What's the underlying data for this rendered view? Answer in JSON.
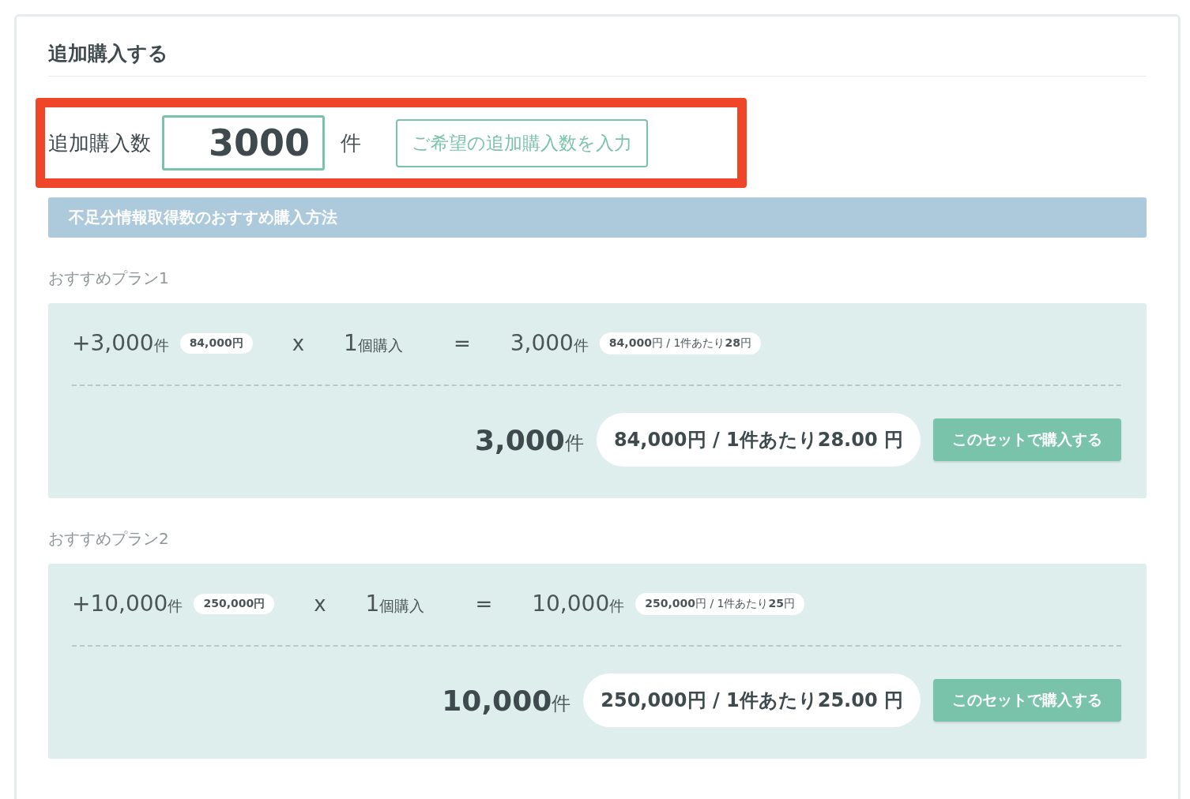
{
  "title": "追加購入する",
  "quantity": {
    "label": "追加購入数",
    "value": "3000",
    "unit": "件",
    "hint": "ご希望の追加購入数を入力",
    "highlighted": true
  },
  "section_bar": "不足分情報取得数のおすすめ購入方法",
  "plans": [
    {
      "title": "おすすめプラン1",
      "amount": "+3,000",
      "amount_unit": "件",
      "price": "84,000円",
      "times": "x",
      "count": "1",
      "count_unit": "個購入",
      "equals": "=",
      "result": "3,000",
      "result_unit": "件",
      "result_price": "**84,000**円 / 1件あたり**28**円",
      "total": "3,000",
      "total_unit": "件",
      "total_price": "**84,000**円 / 1件あたり28.00 円",
      "button": "このセットで購入する"
    },
    {
      "title": "おすすめプラン2",
      "amount": "+10,000",
      "amount_unit": "件",
      "price": "250,000円",
      "times": "x",
      "count": "1",
      "count_unit": "個購入",
      "equals": "=",
      "result": "10,000",
      "result_unit": "件",
      "result_price": "**250,000**円 / 1件あたり**25**円",
      "total": "10,000",
      "total_unit": "件",
      "total_price": "**250,000**円 / 1件あたり25.00 円",
      "button": "このセットで購入する"
    }
  ]
}
